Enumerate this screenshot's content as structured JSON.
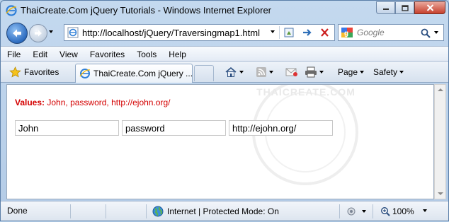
{
  "window": {
    "title": "ThaiCreate.Com jQuery Tutorials - Windows Internet Explorer",
    "controls": [
      "minimize",
      "maximize",
      "close"
    ]
  },
  "address_bar": {
    "url": "http://localhost/jQuery/Traversingmap1.html",
    "icons": [
      "ie-page-icon",
      "compatibility-view-icon",
      "go-arrow-icon",
      "stop-x-icon"
    ]
  },
  "search": {
    "placeholder": "Google"
  },
  "menu": {
    "items": [
      "File",
      "Edit",
      "View",
      "Favorites",
      "Tools",
      "Help"
    ]
  },
  "favorites_bar": {
    "favorites_label": "Favorites",
    "tab_label": "ThaiCreate.Com jQuery ...",
    "page_label": "Page",
    "safety_label": "Safety"
  },
  "page": {
    "values_label": "Values:",
    "values_text": "John, password, http://ejohn.org/",
    "inputs": [
      "John",
      "password",
      "http://ejohn.org/"
    ],
    "watermark_text": "THAICREATE.COM"
  },
  "status_bar": {
    "status_text": "Done",
    "zone_text": "Internet | Protected Mode: On",
    "zoom": "100%"
  },
  "colors": {
    "values_red": "#d40000",
    "ie_blue": "#2d6cc0"
  }
}
